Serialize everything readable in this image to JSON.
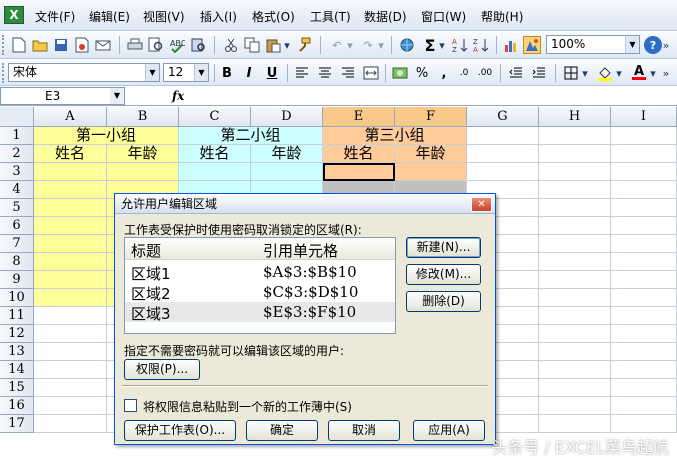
{
  "menu": {
    "items": [
      "文件(F)",
      "编辑(E)",
      "视图(V)",
      "插入(I)",
      "格式(O)",
      "工具(T)",
      "数据(D)",
      "窗口(W)",
      "帮助(H)"
    ]
  },
  "toolbar": {
    "zoom": "100%",
    "font_name": "宋体",
    "font_size": "12",
    "bold_label": "B",
    "italic_label": "I",
    "underline_label": "U",
    "percent_label": "%",
    "comma_label": ","
  },
  "formula_bar": {
    "name_box": "E3",
    "fx_label": "fx"
  },
  "sheet": {
    "columns": [
      "A",
      "B",
      "C",
      "D",
      "E",
      "F",
      "G",
      "H",
      "I"
    ],
    "rows": [
      "1",
      "2",
      "3",
      "4",
      "5",
      "6",
      "7",
      "8",
      "9",
      "10",
      "11",
      "12",
      "13",
      "14",
      "15",
      "16",
      "17"
    ],
    "group1": "第一小组",
    "group2": "第二小组",
    "group3": "第三小组",
    "name_header": "姓名",
    "age_header": "年龄",
    "colors": {
      "yellow": "#ffff99",
      "cyan": "#ccffff",
      "orange": "#ffcc99",
      "gray": "#c0c0c0"
    }
  },
  "dialog": {
    "title": "允许用户编辑区域",
    "intro": "工作表受保护时使用密码取消锁定的区域(R):",
    "col_title": "标题",
    "col_ref": "引用单元格",
    "ranges": [
      {
        "title": "区域1",
        "ref": "$A$3:$B$10"
      },
      {
        "title": "区域2",
        "ref": "$C$3:$D$10"
      },
      {
        "title": "区域3",
        "ref": "$E$3:$F$10"
      }
    ],
    "new_button": "新建(N)...",
    "modify_button": "修改(M)...",
    "delete_button": "删除(D)",
    "users_label": "指定不需要密码就可以编辑该区域的用户:",
    "permissions_button": "权限(P)...",
    "paste_checkbox_label": "将权限信息粘贴到一个新的工作薄中(S)",
    "protect_sheet_button": "保护工作表(O)...",
    "ok_button": "确定",
    "cancel_button": "取消",
    "apply_button": "应用(A)"
  },
  "watermark": "头条号 / EXCEL菜鸟起航"
}
